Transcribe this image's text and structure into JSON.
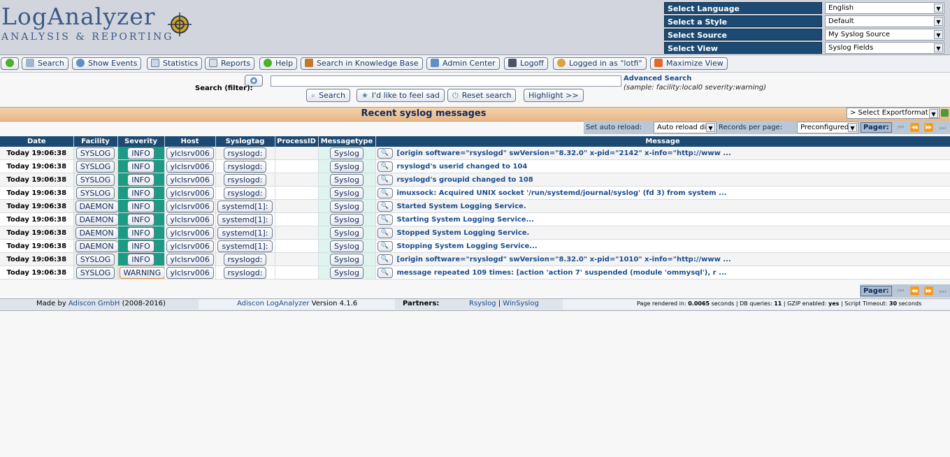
{
  "header": {
    "logo_main": "LogAnalyzer",
    "logo_sub": "ANALYSIS & REPORTING",
    "selectors": [
      {
        "label": "Select Language",
        "value": "English"
      },
      {
        "label": "Select a Style",
        "value": "Default"
      },
      {
        "label": "Select Source",
        "value": "My Syslog Source"
      },
      {
        "label": "Select View",
        "value": "Syslog Fields"
      }
    ]
  },
  "toolbar": {
    "items": [
      {
        "label": "",
        "icon": "green-circle-icon"
      },
      {
        "label": "Search",
        "icon": "magnifier-icon"
      },
      {
        "label": "Show Events",
        "icon": "globe-icon"
      },
      {
        "label": "Statistics",
        "icon": "chart-icon"
      },
      {
        "label": "Reports",
        "icon": "report-icon"
      },
      {
        "label": "Help",
        "icon": "help-icon"
      },
      {
        "label": "Search in Knowledge Base",
        "icon": "books-icon"
      },
      {
        "label": "Admin Center",
        "icon": "star-icon"
      },
      {
        "label": "Logoff",
        "icon": "logoff-icon"
      },
      {
        "label": "Logged in as \"lotfi\"",
        "icon": "user-icon"
      },
      {
        "label": "Maximize View",
        "icon": "maximize-icon"
      }
    ]
  },
  "search": {
    "label": "Search (filter):",
    "value": "",
    "advanced_link": "Advanced Search",
    "sample": "(sample: facility:local0 severity:warning)",
    "buttons": {
      "search": "Search",
      "feel_sad": "I'd like to feel sad",
      "reset": "Reset search",
      "highlight": "Highlight >>"
    }
  },
  "recent": {
    "title": "Recent syslog messages",
    "export_format": "> Select Exportformat <"
  },
  "reload": {
    "set_label": "Set auto reload:",
    "reload_value": "Auto reload di",
    "records_label": "Records per page:",
    "records_value": "Preconfigured",
    "pager_label": "Pager:"
  },
  "table": {
    "columns": [
      "Date",
      "Facility",
      "Severity",
      "Host",
      "Syslogtag",
      "ProcessID",
      "Messagetype",
      "Message"
    ],
    "rows": [
      {
        "date": "Today 19:06:38",
        "facility": "SYSLOG",
        "severity": "INFO",
        "host": "ylclsrv006",
        "tag": "rsyslogd:",
        "pid": "",
        "type": "Syslog",
        "message": "[origin software=\"rsyslogd\" swVersion=\"8.32.0\" x-pid=\"2142\" x-info=\"http://www ..."
      },
      {
        "date": "Today 19:06:38",
        "facility": "SYSLOG",
        "severity": "INFO",
        "host": "ylclsrv006",
        "tag": "rsyslogd:",
        "pid": "",
        "type": "Syslog",
        "message": "rsyslogd's userid changed to 104"
      },
      {
        "date": "Today 19:06:38",
        "facility": "SYSLOG",
        "severity": "INFO",
        "host": "ylclsrv006",
        "tag": "rsyslogd:",
        "pid": "",
        "type": "Syslog",
        "message": "rsyslogd's groupid changed to 108"
      },
      {
        "date": "Today 19:06:38",
        "facility": "SYSLOG",
        "severity": "INFO",
        "host": "ylclsrv006",
        "tag": "rsyslogd:",
        "pid": "",
        "type": "Syslog",
        "message": "imuxsock: Acquired UNIX socket '/run/systemd/journal/syslog' (fd 3) from system ..."
      },
      {
        "date": "Today 19:06:38",
        "facility": "DAEMON",
        "severity": "INFO",
        "host": "ylclsrv006",
        "tag": "systemd[1]:",
        "pid": "",
        "type": "Syslog",
        "message": "Started System Logging Service."
      },
      {
        "date": "Today 19:06:38",
        "facility": "DAEMON",
        "severity": "INFO",
        "host": "ylclsrv006",
        "tag": "systemd[1]:",
        "pid": "",
        "type": "Syslog",
        "message": "Starting System Logging Service..."
      },
      {
        "date": "Today 19:06:38",
        "facility": "DAEMON",
        "severity": "INFO",
        "host": "ylclsrv006",
        "tag": "systemd[1]:",
        "pid": "",
        "type": "Syslog",
        "message": "Stopped System Logging Service."
      },
      {
        "date": "Today 19:06:38",
        "facility": "DAEMON",
        "severity": "INFO",
        "host": "ylclsrv006",
        "tag": "systemd[1]:",
        "pid": "",
        "type": "Syslog",
        "message": "Stopping System Logging Service..."
      },
      {
        "date": "Today 19:06:38",
        "facility": "SYSLOG",
        "severity": "INFO",
        "host": "ylclsrv006",
        "tag": "rsyslogd:",
        "pid": "",
        "type": "Syslog",
        "message": "[origin software=\"rsyslogd\" swVersion=\"8.32.0\" x-pid=\"1010\" x-info=\"http://www ..."
      },
      {
        "date": "Today 19:06:38",
        "facility": "SYSLOG",
        "severity": "WARNING",
        "host": "ylclsrv006",
        "tag": "rsyslogd:",
        "pid": "",
        "type": "Syslog",
        "message": "message repeated 109 times: [action 'action 7' suspended (module 'ommysql'), r ..."
      }
    ]
  },
  "bottom_pager": {
    "label": "Pager:"
  },
  "footer": {
    "made_by_prefix": "Made by",
    "made_by_link": "Adiscon GmbH",
    "made_by_years": "(2008-2016)",
    "product_link": "Adiscon LogAnalyzer",
    "product_version": "Version 4.1.6",
    "partners_label": "Partners:",
    "partner1": "Rsyslog",
    "partner_sep": "|",
    "partner2": "WinSyslog",
    "render_prefix": "Page rendered in:",
    "render_time": "0.0065",
    "render_unit": "seconds",
    "db_label": "| DB queries:",
    "db_value": "11",
    "gzip_label": "| GZIP enabled:",
    "gzip_value": "yes",
    "timeout_label": "| Script Timeout:",
    "timeout_value": "30",
    "timeout_unit": "seconds"
  },
  "colors": {
    "header_dark": "#1c4a72",
    "severity_info": "#1d9a84",
    "recent_bar": "#e7b788",
    "link": "#1b4d8c"
  }
}
